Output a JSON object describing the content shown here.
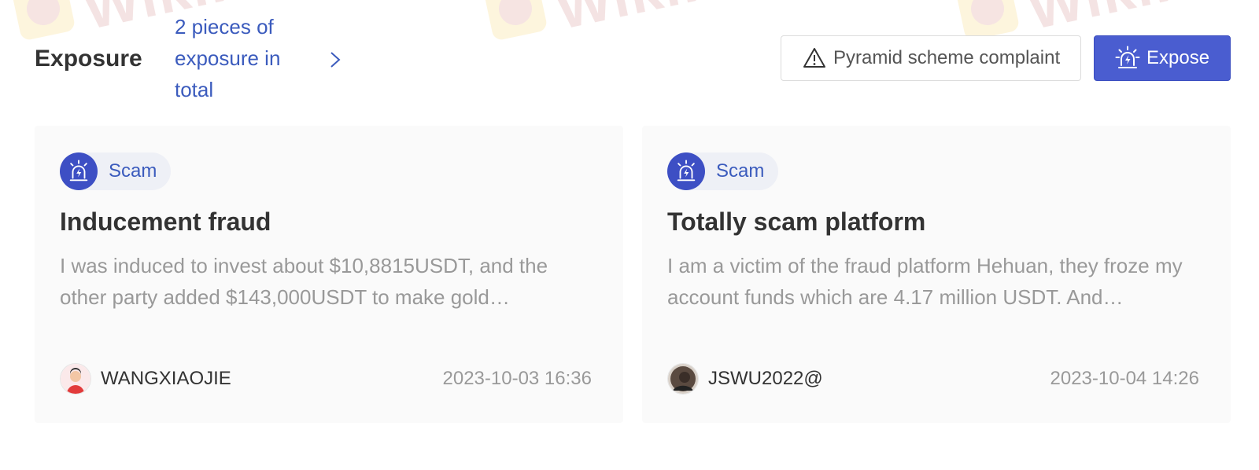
{
  "header": {
    "title": "Exposure",
    "total_text": "2 pieces of exposure in total",
    "complaint_button": "Pyramid scheme complaint",
    "expose_button": "Expose"
  },
  "watermark": {
    "text": "WikiFX"
  },
  "colors": {
    "accent": "#4a5dd0",
    "link": "#3b5bbd",
    "card_bg": "#fafafa"
  },
  "cards": [
    {
      "tag": "Scam",
      "title": "Inducement fraud",
      "body": "I was induced to invest about $10,8815USDT, and the other party added $143,000USDT to make gold…",
      "author": "WANGXIAOJIE",
      "time": "2023-10-03 16:36"
    },
    {
      "tag": "Scam",
      "title": "Totally scam platform",
      "body": "I am a victim of the fraud platform Hehuan, they froze my account funds which are 4.17 million USDT. And…",
      "author": "JSWU2022@",
      "time": "2023-10-04 14:26"
    }
  ]
}
